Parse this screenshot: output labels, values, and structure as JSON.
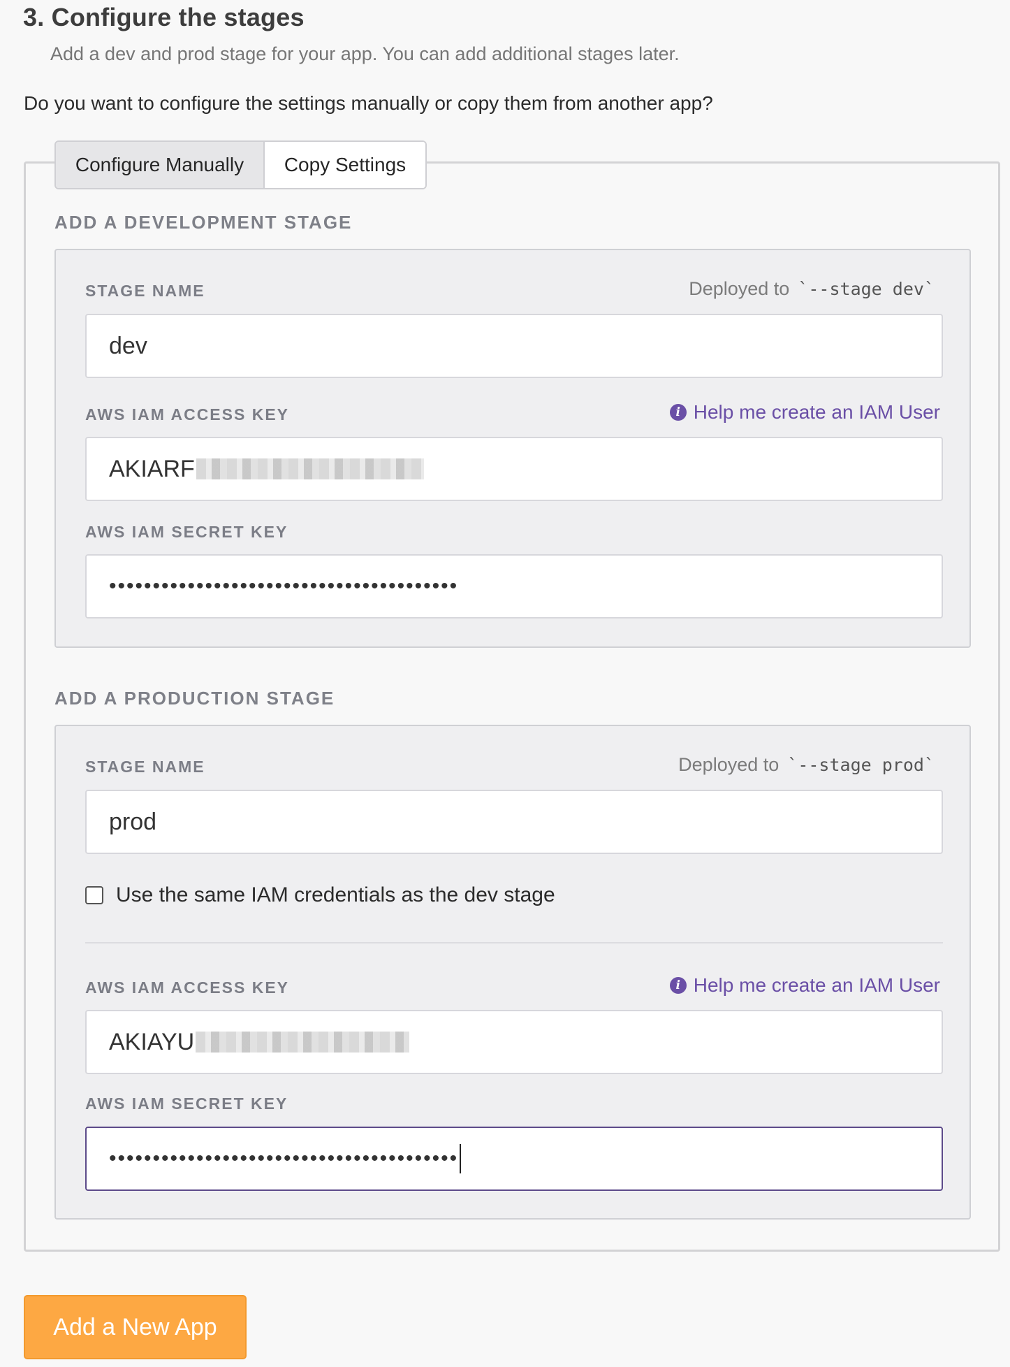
{
  "header": {
    "title": "3. Configure the stages",
    "subtitle": "Add a dev and prod stage for your app. You can add additional stages later.",
    "question": "Do you want to configure the settings manually or copy them from another app?"
  },
  "tabs": [
    {
      "label": "Configure Manually",
      "active": true
    },
    {
      "label": "Copy Settings",
      "active": false
    }
  ],
  "dev_stage": {
    "heading": "ADD A DEVELOPMENT STAGE",
    "stage_name_label": "STAGE NAME",
    "deployed_to_text": "Deployed to",
    "deployed_to_code": "`--stage dev`",
    "stage_name_value": "dev",
    "access_key_label": "AWS IAM ACCESS KEY",
    "help_link": "Help me create an IAM User",
    "access_key_value": "AKIARF",
    "secret_key_label": "AWS IAM SECRET KEY",
    "secret_key_value": "••••••••••••••••••••••••••••••••••••••••"
  },
  "prod_stage": {
    "heading": "ADD A PRODUCTION STAGE",
    "stage_name_label": "STAGE NAME",
    "deployed_to_text": "Deployed to",
    "deployed_to_code": "`--stage prod`",
    "stage_name_value": "prod",
    "same_credentials_label": "Use the same IAM credentials as the dev stage",
    "same_credentials_checked": false,
    "access_key_label": "AWS IAM ACCESS KEY",
    "help_link": "Help me create an IAM User",
    "access_key_value": "AKIAYU",
    "secret_key_label": "AWS IAM SECRET KEY",
    "secret_key_value": "••••••••••••••••••••••••••••••••••••••••"
  },
  "actions": {
    "submit_label": "Add a New App"
  },
  "icons": {
    "info": "info-circle-icon"
  },
  "colors": {
    "accent_link": "#6a4fa6",
    "primary_button": "#fda843"
  }
}
